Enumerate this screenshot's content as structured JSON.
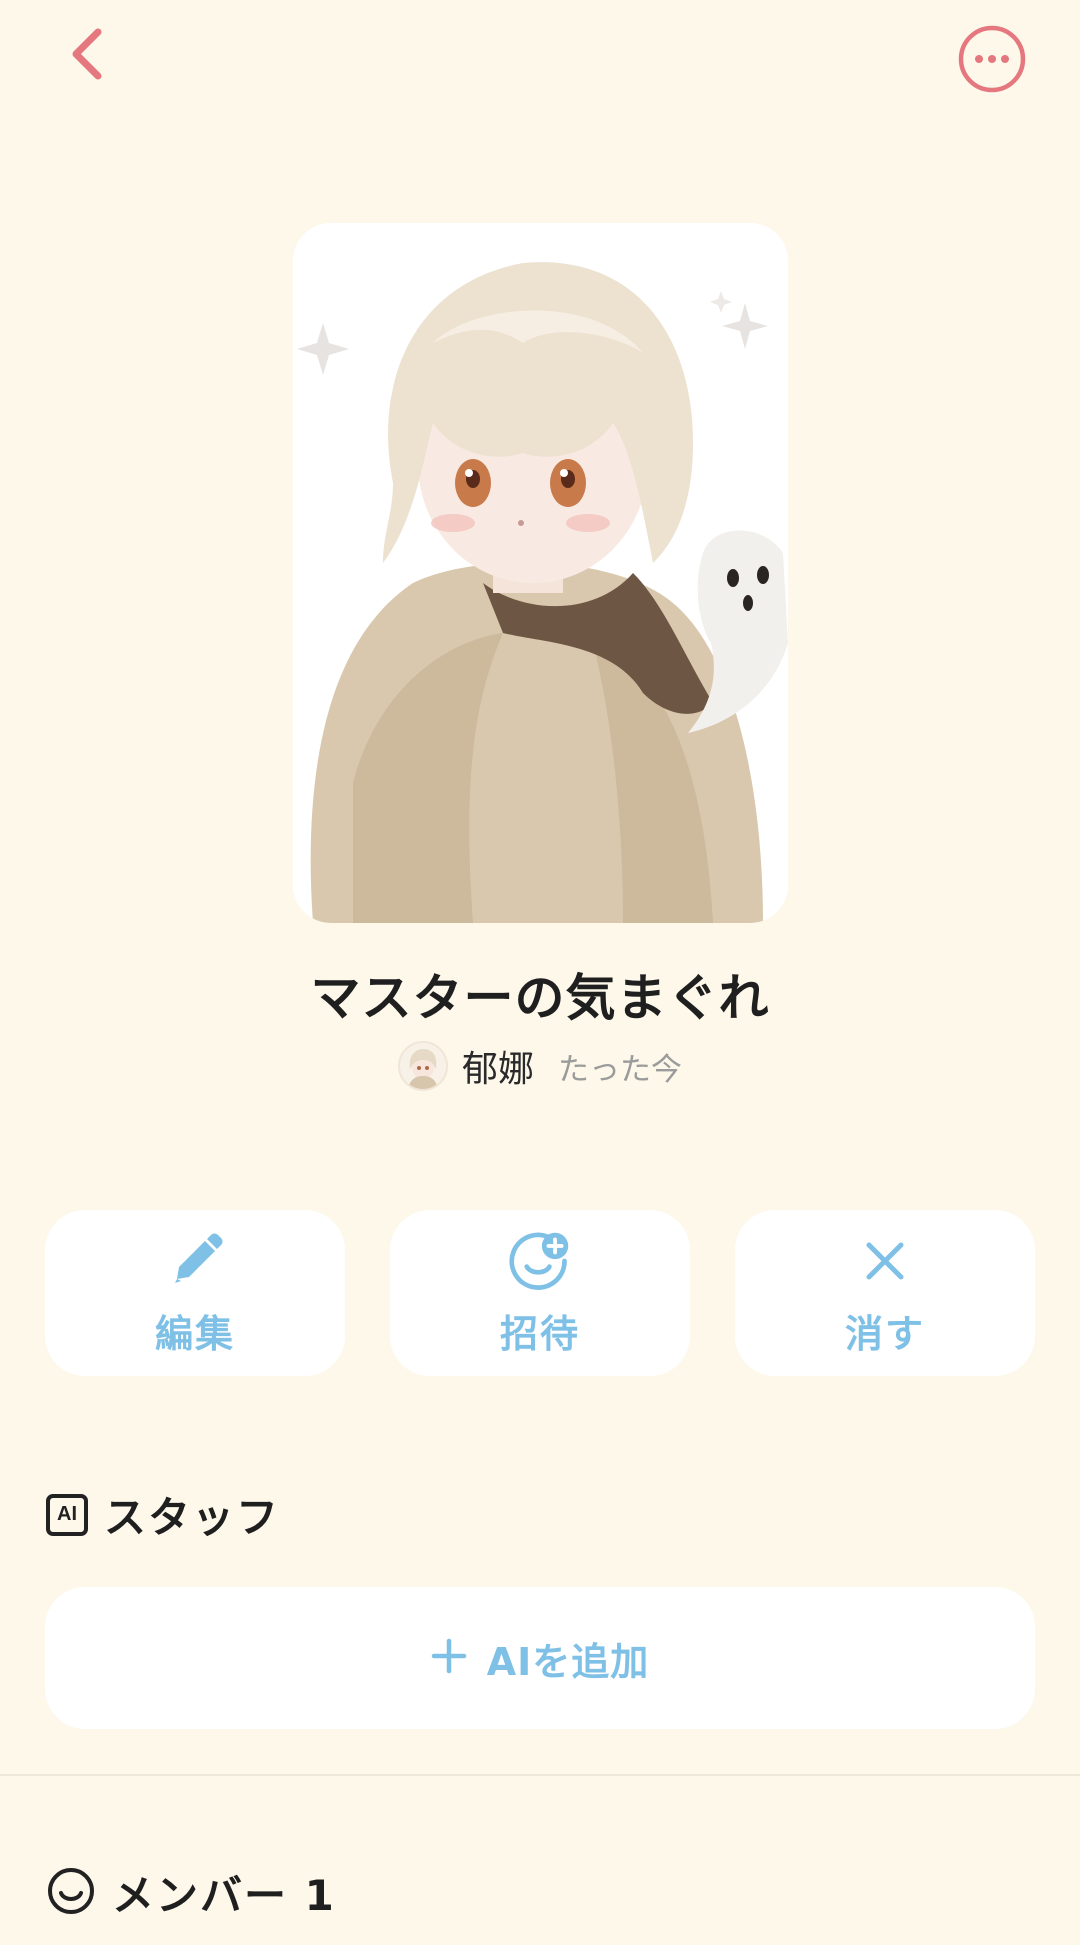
{
  "header": {
    "back_icon": "chevron-left-icon",
    "more_icon": "more-horizontal-icon",
    "accent_color": "#E5787F"
  },
  "room": {
    "title": "マスターの気まぐれ",
    "author_name": "郁娜",
    "time_ago": "たった今"
  },
  "actions": [
    {
      "label": "編集",
      "icon": "pencil-icon"
    },
    {
      "label": "招待",
      "icon": "add-person-icon"
    },
    {
      "label": "消す",
      "icon": "close-icon"
    }
  ],
  "staff": {
    "heading": "スタッフ",
    "ai_badge": "AI",
    "add_label": "AIを追加"
  },
  "members": {
    "heading": "メンバー 1"
  },
  "colors": {
    "background": "#FDF8EA",
    "button_text": "#7FC0E6",
    "card": "#FFFFFF"
  }
}
